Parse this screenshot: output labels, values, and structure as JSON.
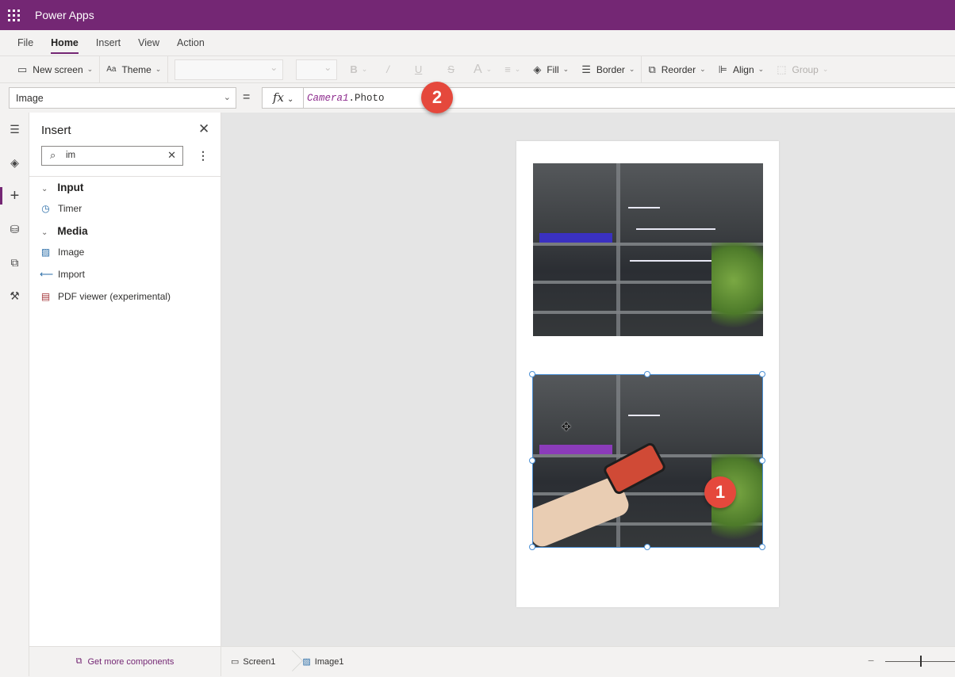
{
  "app": {
    "title": "Power Apps"
  },
  "menu": {
    "items": [
      {
        "label": "File",
        "active": false
      },
      {
        "label": "Home",
        "active": true
      },
      {
        "label": "Insert",
        "active": false
      },
      {
        "label": "View",
        "active": false
      },
      {
        "label": "Action",
        "active": false
      }
    ]
  },
  "toolbar": {
    "new_screen": "New screen",
    "theme": "Theme",
    "fill": "Fill",
    "border": "Border",
    "reorder": "Reorder",
    "align": "Align",
    "group": "Group"
  },
  "formula": {
    "property": "Image",
    "equals": "=",
    "fx": "fx",
    "ident": "Camera1",
    "rest": ".Photo"
  },
  "insert_panel": {
    "title": "Insert",
    "search_value": "im",
    "categories": [
      {
        "name": "Input",
        "items": [
          {
            "label": "Timer",
            "icon": "timer-icon"
          }
        ]
      },
      {
        "name": "Media",
        "items": [
          {
            "label": "Image",
            "icon": "image-icon"
          },
          {
            "label": "Import",
            "icon": "import-icon"
          },
          {
            "label": "PDF viewer (experimental)",
            "icon": "pdf-icon"
          }
        ]
      }
    ],
    "footer": "Get more components"
  },
  "statusbar": {
    "screen": "Screen1",
    "control": "Image1"
  },
  "annotations": {
    "badge1": "1",
    "badge2": "2"
  },
  "colors": {
    "brand": "#742774",
    "selection": "#4a8fd4",
    "badge": "#e5483c"
  }
}
